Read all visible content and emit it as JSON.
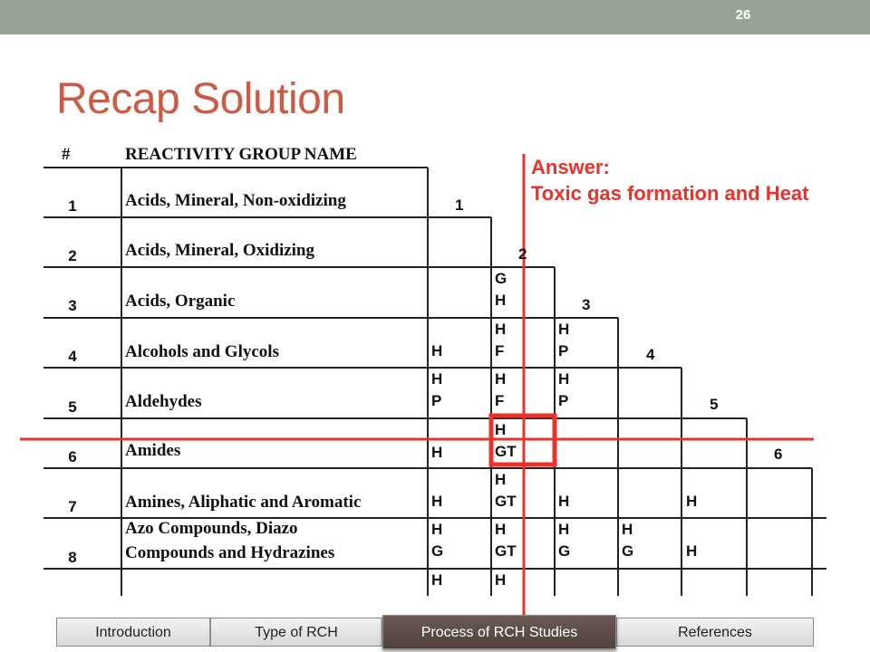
{
  "slide_number": "26",
  "title": "Recap Solution",
  "table": {
    "header_num": "#",
    "header_name": "REACTIVITY GROUP NAME",
    "rows": [
      {
        "num": "1",
        "name": "Acids, Mineral, Non-oxidizing"
      },
      {
        "num": "2",
        "name": "Acids, Mineral, Oxidizing"
      },
      {
        "num": "3",
        "name": "Acids, Organic"
      },
      {
        "num": "4",
        "name": "Alcohols and Glycols"
      },
      {
        "num": "5",
        "name": "Aldehydes"
      },
      {
        "num": "6",
        "name": "Amides"
      },
      {
        "num": "7",
        "name": "Amines, Aliphatic and Aromatic"
      },
      {
        "num": "8",
        "name_line1": "Azo Compounds, Diazo",
        "name_line2": "Compounds and Hydrazines"
      }
    ],
    "diagonal_labels": [
      "1",
      "2",
      "3",
      "4",
      "5",
      "6"
    ],
    "cells": {
      "r3c2": "G\nH",
      "r4c1": "H",
      "r4c2": "H\nF",
      "r4c3": "H\nP",
      "r5c1": "H\nP",
      "r5c2": "H\nF",
      "r5c3": "H\nP",
      "r6c1": "H",
      "r6c2": "H\nGT",
      "r7c1": "H",
      "r7c2": "H\nGT",
      "r7c3": "H",
      "r7c5": "H",
      "r8c1": "H\nG",
      "r8c2": "H\nGT",
      "r8c3": "H\nG",
      "r8c4": "H\nG",
      "r8c5": "H",
      "r9c1": "H",
      "r9c2": "H"
    }
  },
  "answer": {
    "label": "Answer:",
    "text": "Toxic gas formation and Heat"
  },
  "nav": {
    "tabs": [
      "Introduction",
      "Type of RCH",
      "Process of RCH Studies",
      "References"
    ],
    "active": "Process of RCH Studies"
  },
  "colors": {
    "title": "#cc5b45",
    "annotation": "#e8322a",
    "topbar": "#97a397",
    "active_tab": "#5a4a45"
  }
}
